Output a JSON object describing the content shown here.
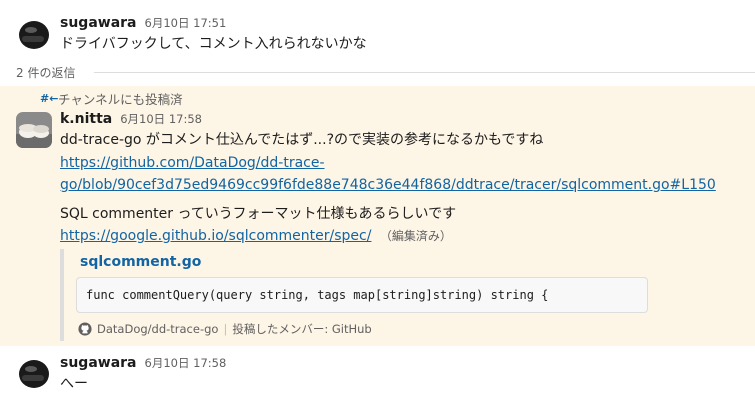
{
  "messages": [
    {
      "author": "sugawara",
      "timestamp": "6月10日 17:51",
      "text": "ドライバフックして、コメント入れられないかな"
    },
    {
      "author": "k.nitta",
      "timestamp": "6月10日 17:58",
      "line1": "dd-trace-go がコメント仕込んでたはず...?ので実装の参考になるかもですね",
      "link1_part1": "https://github.com/DataDog/dd-trace-",
      "link1_part2": "go/blob/90cef3d75ed9469cc99f6fde88e748c36e44f868/ddtrace/tracer/sqlcomment.go#L150",
      "line2": " SQL commenter っていうフォーマット仕様もあるらしいです",
      "link2": "https://google.github.io/sqlcommenter/spec/",
      "edited": "（編集済み）",
      "attachment": {
        "title": "sqlcomment.go",
        "code": "func commentQuery(query string, tags map[string]string) string {",
        "repo": "DataDog/dd-trace-go",
        "posted_by": "投稿したメンバー: GitHub"
      }
    },
    {
      "author": "sugawara",
      "timestamp": "6月10日 17:58",
      "text": "へー"
    }
  ],
  "thread": {
    "reply_count": "2 件の返信",
    "also_sent_icon": "#←",
    "also_sent_label": "チャンネルにも投稿済"
  },
  "colors": {
    "highlight_bg": "#fdf5e6",
    "link": "#1264a3",
    "muted": "#616061"
  },
  "icons": [
    "helmet-avatar-icon",
    "sushi-avatar-icon",
    "channel-arrow-icon",
    "github-icon"
  ]
}
